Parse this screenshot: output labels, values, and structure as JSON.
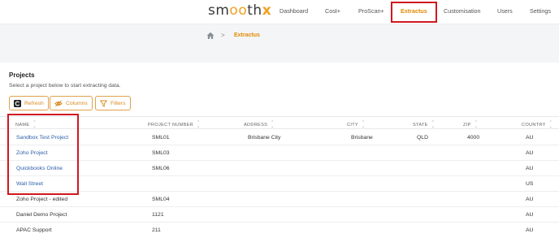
{
  "brand": {
    "logo_prefix": "sm",
    "logo_mid": "oo",
    "logo_th": "th",
    "logo_x": "x"
  },
  "nav": {
    "items": [
      {
        "label": "Dashboard"
      },
      {
        "label": "Cost+"
      },
      {
        "label": "ProScan+"
      },
      {
        "label": "Extractus"
      },
      {
        "label": "Customisation"
      },
      {
        "label": "Users"
      },
      {
        "label": "Settings"
      }
    ],
    "active": "Extractus"
  },
  "breadcrumb": {
    "separator": ">",
    "current": "Extractus"
  },
  "projects": {
    "title": "Projects",
    "subtitle": "Select a project below to start extracting data.",
    "buttons": {
      "refresh": "Refresh",
      "columns": "Columns",
      "filters": "Filters"
    },
    "columns": [
      "NAME",
      "PROJECT NUMBER",
      "ADDRESS",
      "CITY",
      "STATE",
      "ZIP",
      "COUNTRY"
    ],
    "rows": [
      {
        "name": "Sandbox Test Project",
        "number": "SML01",
        "address": "Brisbane City",
        "city": "Brisbane",
        "state": "QLD",
        "zip": "4000",
        "country": "AU"
      },
      {
        "name": "Zoho Project",
        "number": "SML03",
        "address": "",
        "city": "",
        "state": "",
        "zip": "",
        "country": "AU"
      },
      {
        "name": "Quickbooks Online",
        "number": "SML06",
        "address": "",
        "city": "",
        "state": "",
        "zip": "",
        "country": "AU"
      },
      {
        "name": "Wall Street",
        "number": "",
        "address": "",
        "city": "",
        "state": "",
        "zip": "",
        "country": "US"
      },
      {
        "name": "Zoho Project - edited",
        "number": "SML04",
        "address": "",
        "city": "",
        "state": "",
        "zip": "",
        "country": "AU"
      },
      {
        "name": "Daniel Demo Project",
        "number": "1121",
        "address": "",
        "city": "",
        "state": "",
        "zip": "",
        "country": "AU"
      },
      {
        "name": "APAC Support",
        "number": "211",
        "address": "",
        "city": "",
        "state": "",
        "zip": "",
        "country": "AU"
      }
    ]
  },
  "colors": {
    "accent": "#e08a00",
    "highlight": "#d0181e",
    "link": "#2a5ea8"
  }
}
